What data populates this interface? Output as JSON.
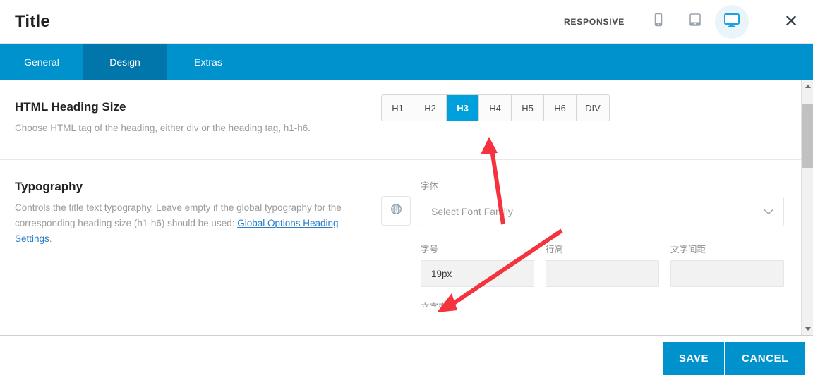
{
  "header": {
    "title": "Title",
    "responsive_label": "RESPONSIVE",
    "devices": [
      {
        "name": "mobile-device-button",
        "icon": "phone-icon",
        "active": false
      },
      {
        "name": "tablet-device-button",
        "icon": "tablet-icon",
        "active": false
      },
      {
        "name": "desktop-device-button",
        "icon": "desktop-icon",
        "active": true
      }
    ],
    "close_icon": "close-icon"
  },
  "tabs": [
    {
      "label": "General",
      "active": false
    },
    {
      "label": "Design",
      "active": true
    },
    {
      "label": "Extras",
      "active": false
    }
  ],
  "sections": {
    "heading_size": {
      "title": "HTML Heading Size",
      "description": "Choose HTML tag of the heading, either div or the heading tag, h1-h6.",
      "options": [
        "H1",
        "H2",
        "H3",
        "H4",
        "H5",
        "H6",
        "DIV"
      ],
      "selected": "H3"
    },
    "typography": {
      "title": "Typography",
      "desc_before_link": "Controls the title text typography. Leave empty if the global typography for the corresponding heading size (h1-h6) should be used: ",
      "link_text": "Global Options Heading Settings",
      "desc_after_link": ".",
      "globe_icon": "globe-icon",
      "font_family": {
        "label": "字体",
        "value": "Select Font Family",
        "chevron_icon": "chevron-down-icon"
      },
      "font_size": {
        "label": "字号",
        "value": "19px"
      },
      "line_height": {
        "label": "行高",
        "value": ""
      },
      "letter_spacing": {
        "label": "文字间距",
        "value": ""
      },
      "partial_label": "文字变换"
    }
  },
  "footer": {
    "save_label": "SAVE",
    "cancel_label": "CANCEL"
  },
  "colors": {
    "tab_bar": "#0092cd",
    "tab_active": "#0076ab",
    "accent_selected": "#00a0dc",
    "annotation": "#f5333f",
    "link": "#2a7cc7"
  }
}
